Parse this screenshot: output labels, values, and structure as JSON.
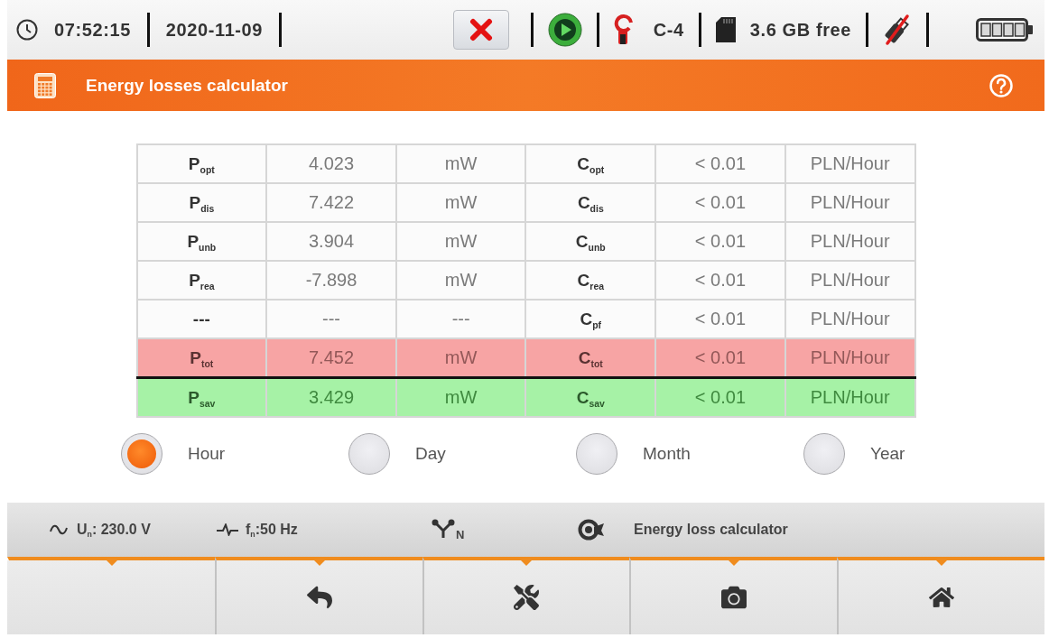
{
  "status_bar": {
    "time": "07:52:15",
    "date": "2020-11-09",
    "clamp": "C-4",
    "memory": "3.6 GB free"
  },
  "title_bar": {
    "title": "Energy losses calculator"
  },
  "table": {
    "rows": [
      {
        "kind": "plain",
        "cells": [
          "P$_{opt}$",
          "4.023",
          "mW",
          "C$_{opt}$",
          "< 0.01",
          "PLN/Hour"
        ]
      },
      {
        "kind": "plain",
        "cells": [
          "P$_{dis}$",
          "7.422",
          "mW",
          "C$_{dis}$",
          "< 0.01",
          "PLN/Hour"
        ]
      },
      {
        "kind": "plain",
        "cells": [
          "P$_{unb}$",
          "3.904",
          "mW",
          "C$_{unb}$",
          "< 0.01",
          "PLN/Hour"
        ]
      },
      {
        "kind": "plain",
        "cells": [
          "P$_{rea}$",
          "-7.898",
          "mW",
          "C$_{rea}$",
          "< 0.01",
          "PLN/Hour"
        ]
      },
      {
        "kind": "plain",
        "cells": [
          "---",
          "---",
          "---",
          "C$_{pf}$",
          "< 0.01",
          "PLN/Hour"
        ]
      },
      {
        "kind": "total",
        "cells": [
          "P$_{tot}$",
          "7.452",
          "mW",
          "C$_{tot}$",
          "< 0.01",
          "PLN/Hour"
        ]
      },
      {
        "kind": "saving",
        "cells": [
          "P$_{sav}$",
          "3.429",
          "mW",
          "C$_{sav}$",
          "< 0.01",
          "PLN/Hour"
        ]
      }
    ]
  },
  "period_options": [
    {
      "label": "Hour",
      "selected": true
    },
    {
      "label": "Day",
      "selected": false
    },
    {
      "label": "Month",
      "selected": false
    },
    {
      "label": "Year",
      "selected": false
    }
  ],
  "info_bar": {
    "voltage": "U$_{n}$: 230.0 V",
    "frequency": "f$_{n}$:50 Hz",
    "wiring": "N",
    "mode": "Energy loss calculator"
  }
}
